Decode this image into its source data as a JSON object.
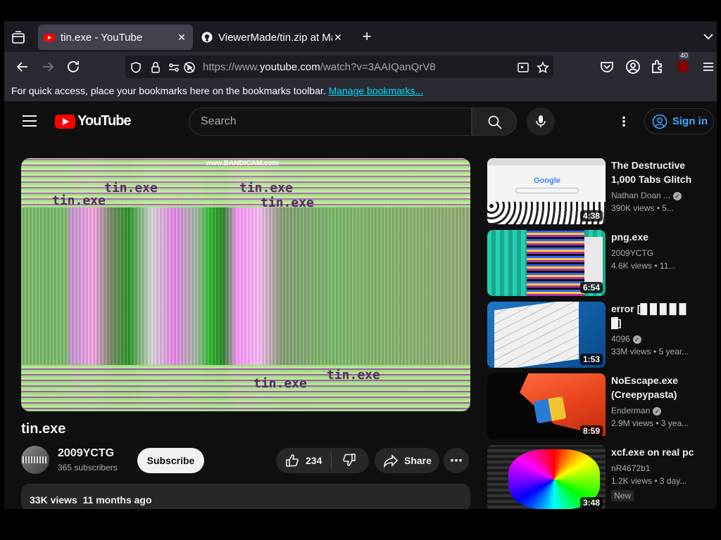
{
  "browser": {
    "tabs": [
      {
        "title": "tin.exe - YouTube",
        "active": true
      },
      {
        "title": "ViewerMade/tin.zip at Ma",
        "active": false
      }
    ],
    "url": {
      "prefix": "https://www.",
      "domain": "youtube.com",
      "path": "/watch?v=3AAIQanQrV8"
    },
    "extension_badge": "40",
    "bookmarks_bar": {
      "message": "For quick access, place your bookmarks here on the bookmarks toolbar.",
      "link": "Manage bookmarks..."
    }
  },
  "youtube": {
    "logo_text": "YouTube",
    "search_placeholder": "Search",
    "signin_label": "Sign in",
    "player": {
      "watermark": "www.BANDICAM.com",
      "glitch_labels": [
        "tin.exe",
        "tin.exe",
        "tin.exe",
        "tin.exe",
        "tin.exe",
        "tin.exe"
      ]
    },
    "video": {
      "title": "tin.exe",
      "channel": "2009YCTG",
      "subscribers": "365 subscribers",
      "subscribe_label": "Subscribe",
      "likes": "234",
      "share_label": "Share",
      "views": "33K views",
      "age": "11 months ago"
    },
    "recommendations": [
      {
        "title": "The Destructive 1,000 Tabs Glitch",
        "channel": "Nathan Doan ...",
        "verified": true,
        "views": "390K views",
        "age": "5...",
        "duration": "4:38"
      },
      {
        "title": "png.exe",
        "channel": "2009YCTG",
        "verified": false,
        "views": "4.6K views",
        "age": "11...",
        "duration": "6:54"
      },
      {
        "title": "error [█ █ █ █ █ █]",
        "channel": "4096",
        "verified": true,
        "views": "33M views",
        "age": "5 year...",
        "duration": "1:53"
      },
      {
        "title": "NoEscape.exe (Creepypasta)",
        "channel": "Enderman",
        "verified": true,
        "views": "2.9M views",
        "age": "3 yea...",
        "duration": "8:59"
      },
      {
        "title": "xcf.exe on real pc",
        "channel": "nR4672b1",
        "verified": false,
        "views": "1.2K views",
        "age": "3 day...",
        "duration": "3:48",
        "badge": "New"
      }
    ]
  }
}
